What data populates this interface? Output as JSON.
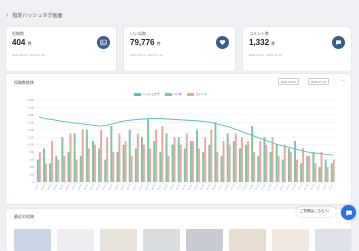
{
  "header": {
    "back_icon": "chevron-left-icon",
    "title": "指定ハッシュタグ画面"
  },
  "metrics": [
    {
      "label": "投稿数",
      "value": "404",
      "unit": "件",
      "sub": "2021.06.01 - 2021.07.19",
      "icon": "image-icon"
    },
    {
      "label": "いいね数",
      "value": "79,776",
      "unit": "件",
      "sub": "2021.06.01 - 2021.07.19",
      "icon": "heart-icon"
    },
    {
      "label": "コメント数",
      "value": "1,332",
      "unit": "件",
      "sub": "2021.06.01 - 2021.07.19",
      "icon": "comment-icon"
    }
  ],
  "chart_panel": {
    "title": "投稿数推移",
    "date_from": "2021.06.01",
    "date_to": "2021.07.19",
    "menu_icon": "more-icon"
  },
  "chart_data": {
    "type": "bar",
    "title": "",
    "ylim": [
      0,
      2200
    ],
    "y_ticks": [
      "2,200",
      "2,000",
      "1,800",
      "1,600",
      "1,400",
      "1,200",
      "1,000",
      "800",
      "600",
      "400",
      "200",
      "0"
    ],
    "categories": [
      "06-01",
      "06-02",
      "06-03",
      "06-04",
      "06-05",
      "06-06",
      "06-07",
      "06-08",
      "06-09",
      "06-10",
      "06-11",
      "06-12",
      "06-13",
      "06-14",
      "06-15",
      "06-16",
      "06-17",
      "06-18",
      "06-19",
      "06-20",
      "06-21",
      "06-22",
      "06-23",
      "06-24",
      "06-25",
      "06-26",
      "06-27",
      "06-28",
      "06-29",
      "06-30",
      "07-01",
      "07-02",
      "07-03",
      "07-04",
      "07-05",
      "07-06",
      "07-07",
      "07-08",
      "07-09",
      "07-10",
      "07-11",
      "07-12",
      "07-13",
      "07-14",
      "07-15",
      "07-16",
      "07-17",
      "07-18",
      "07-19"
    ],
    "series": [
      {
        "name": "ハッシュタグ",
        "kind": "line",
        "color": "#5bbfb5",
        "values": [
          1750,
          1700,
          1680,
          1650,
          1620,
          1600,
          1580,
          1560,
          1540,
          1520,
          1500,
          1520,
          1560,
          1600,
          1640,
          1660,
          1680,
          1690,
          1700,
          1710,
          1700,
          1690,
          1680,
          1670,
          1660,
          1650,
          1640,
          1620,
          1600,
          1560,
          1520,
          1480,
          1420,
          1360,
          1300,
          1240,
          1180,
          1120,
          1060,
          1000,
          960,
          920,
          880,
          840,
          800,
          780,
          760,
          740,
          720
        ]
      },
      {
        "name": "いいね",
        "kind": "bar",
        "color": "#7fc4a4",
        "values": [
          600,
          900,
          500,
          700,
          1200,
          800,
          1300,
          700,
          1400,
          1100,
          900,
          600,
          1500,
          800,
          1000,
          1400,
          900,
          1200,
          1700,
          1100,
          800,
          1300,
          1000,
          1200,
          900,
          1100,
          1400,
          800,
          1000,
          1600,
          700,
          1300,
          1100,
          900,
          1000,
          1500,
          700,
          1200,
          800,
          1000,
          600,
          900,
          1100,
          500,
          700,
          800,
          400,
          600,
          500
        ]
      },
      {
        "name": "コメント",
        "kind": "bar",
        "color": "#e8a9a0",
        "values": [
          800,
          500,
          1100,
          600,
          700,
          1300,
          600,
          1400,
          900,
          1000,
          1400,
          1200,
          800,
          1300,
          1100,
          700,
          1300,
          1000,
          900,
          1400,
          1500,
          700,
          1200,
          1000,
          1300,
          1100,
          900,
          1200,
          1400,
          800,
          1100,
          1000,
          1300,
          1200,
          1100,
          800,
          1100,
          1000,
          1200,
          700,
          1000,
          800,
          600,
          900,
          700,
          500,
          800,
          400,
          600
        ]
      }
    ]
  },
  "posts_panel": {
    "title": "最近の投稿",
    "thumbnails": [
      "#c9d6e3",
      "#eceef1",
      "#e8e2dc",
      "#d9dde2",
      "#c8ccd2",
      "#e6dccf",
      "#f1e8e4",
      "#dde2e8"
    ]
  },
  "help_bubble": "ご質問はこちらへ！",
  "chat_button": {
    "icon": "chat-icon"
  },
  "colors": {
    "accent": "#3d5a8c",
    "chat": "#2f6fe0"
  }
}
